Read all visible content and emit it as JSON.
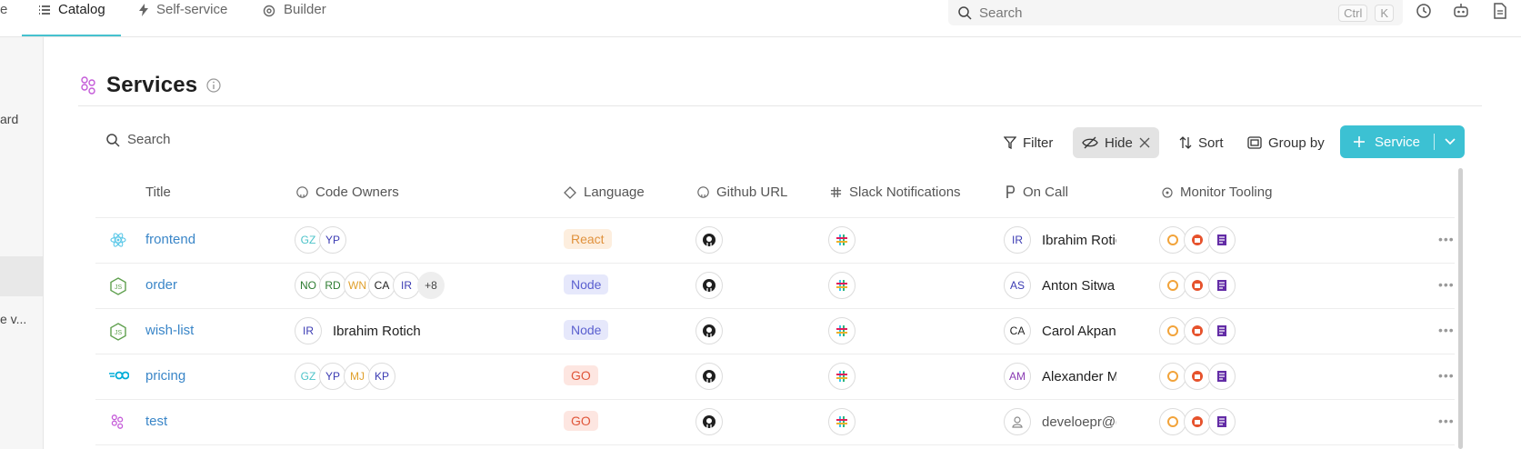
{
  "nav": {
    "cut_label": "e",
    "tabs": [
      {
        "label": "Catalog"
      },
      {
        "label": "Self-service"
      },
      {
        "label": "Builder"
      }
    ]
  },
  "global_search": {
    "placeholder": "Search",
    "kbd_ctrl": "Ctrl",
    "kbd_k": "K"
  },
  "sidebar": {
    "cut_item_1": "ard",
    "cut_item_2": "e v..."
  },
  "page": {
    "title": "Services"
  },
  "toolbar": {
    "search_placeholder": "Search",
    "filter": "Filter",
    "hide": "Hide",
    "sort": "Sort",
    "group_by": "Group by",
    "primary": "Service"
  },
  "columns": [
    "Title",
    "Code Owners",
    "Language",
    "Github URL",
    "Slack Notifications",
    "On Call",
    "Monitor Tooling"
  ],
  "rows": [
    {
      "title": "frontend",
      "owners": [
        "GZ",
        "YP"
      ],
      "language": "React",
      "oncall_initials": "IR",
      "oncall": "Ibrahim Rotich"
    },
    {
      "title": "order",
      "owners": [
        "NO",
        "RD",
        "WN",
        "CA",
        "IR"
      ],
      "owners_more": "+8",
      "language": "Node",
      "oncall_initials": "AS",
      "oncall": "Anton Sitwa"
    },
    {
      "title": "wish-list",
      "owners": [
        "IR"
      ],
      "owner_name": "Ibrahim Rotich",
      "language": "Node",
      "oncall_initials": "CA",
      "oncall": "Carol Akpan"
    },
    {
      "title": "pricing",
      "owners": [
        "GZ",
        "YP",
        "MJ",
        "KP"
      ],
      "language": "GO",
      "oncall_initials": "AM",
      "oncall": "Alexander M"
    },
    {
      "title": "test",
      "owners": [],
      "language": "GO",
      "oncall_initials": "",
      "oncall": "develoepr@g"
    }
  ],
  "colors": {
    "accent": "#3cc1d3",
    "link": "#3a86c8",
    "react_bg": "#fdeede",
    "react_fg": "#e0913c",
    "node_bg": "#e6e8fb",
    "node_fg": "#5a5fcf",
    "go_bg": "#fde6e1",
    "go_fg": "#e0563a"
  }
}
